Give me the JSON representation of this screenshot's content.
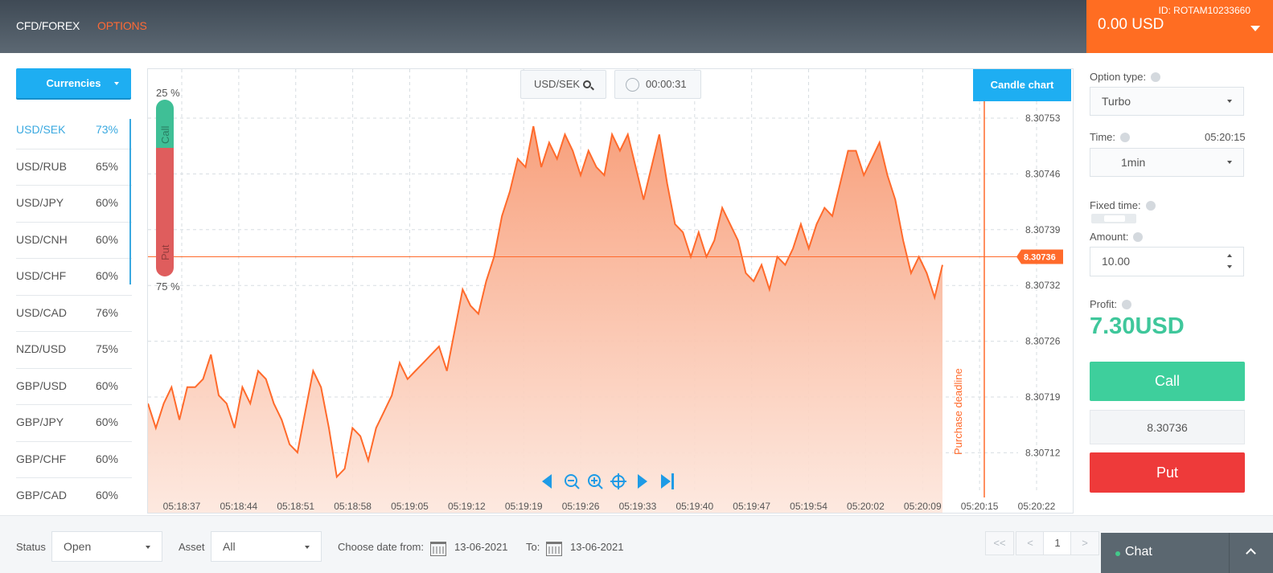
{
  "nav": {
    "cfd": "CFD/FOREX",
    "options": "OPTIONS"
  },
  "account": {
    "id": "ID: ROTAM10233660",
    "balance": "0.00 USD"
  },
  "sidebar": {
    "currencies_label": "Currencies",
    "pairs": [
      {
        "name": "USD/SEK",
        "pct": "73%",
        "active": true
      },
      {
        "name": "USD/RUB",
        "pct": "65%"
      },
      {
        "name": "USD/JPY",
        "pct": "60%"
      },
      {
        "name": "USD/CNH",
        "pct": "60%"
      },
      {
        "name": "USD/CHF",
        "pct": "60%"
      },
      {
        "name": "USD/CAD",
        "pct": "76%"
      },
      {
        "name": "NZD/USD",
        "pct": "75%"
      },
      {
        "name": "GBP/USD",
        "pct": "60%"
      },
      {
        "name": "GBP/JPY",
        "pct": "60%"
      },
      {
        "name": "GBP/CHF",
        "pct": "60%"
      },
      {
        "name": "GBP/CAD",
        "pct": "60%"
      }
    ]
  },
  "chart": {
    "pair": "USD/SEK",
    "timer": "00:00:31",
    "candle_label": "Candle chart",
    "call_pct": "25 %",
    "put_pct": "75 %",
    "call_label": "Call",
    "put_label": "Put",
    "deadline_label": "Purchase deadline",
    "current_price": "8.30736"
  },
  "chart_data": {
    "type": "area",
    "y_ticks": [
      "8.30753",
      "8.30746",
      "8.30739",
      "8.30732",
      "8.30726",
      "8.30719",
      "8.30712"
    ],
    "x_ticks": [
      "05:18:37",
      "05:18:44",
      "05:18:51",
      "05:18:58",
      "05:19:05",
      "05:19:12",
      "05:19:19",
      "05:19:26",
      "05:19:33",
      "05:19:40",
      "05:19:47",
      "05:19:54",
      "05:20:02",
      "05:20:09",
      "05:20:15",
      "05:20:22"
    ],
    "ylim": [
      8.30705,
      8.30758
    ],
    "t_start": 0,
    "t_step": 1,
    "values": [
      8.30718,
      8.30715,
      8.30718,
      8.3072,
      8.30716,
      8.3072,
      8.3072,
      8.30721,
      8.30724,
      8.30719,
      8.30718,
      8.30715,
      8.3072,
      8.30718,
      8.30722,
      8.30721,
      8.30718,
      8.30716,
      8.30713,
      8.30712,
      8.30717,
      8.30722,
      8.3072,
      8.30715,
      8.30709,
      8.3071,
      8.30715,
      8.30714,
      8.30711,
      8.30715,
      8.30717,
      8.30719,
      8.30723,
      8.30721,
      8.30722,
      8.30723,
      8.30724,
      8.30725,
      8.30722,
      8.30727,
      8.30732,
      8.3073,
      8.30729,
      8.30733,
      8.30736,
      8.30741,
      8.30744,
      8.30748,
      8.30747,
      8.30752,
      8.30747,
      8.3075,
      8.30748,
      8.30751,
      8.30749,
      8.30746,
      8.30749,
      8.30747,
      8.30746,
      8.30751,
      8.30749,
      8.30751,
      8.30747,
      8.30743,
      8.30747,
      8.30751,
      8.30745,
      8.3074,
      8.30739,
      8.30736,
      8.30739,
      8.30736,
      8.30738,
      8.30742,
      8.3074,
      8.30738,
      8.30734,
      8.30733,
      8.30735,
      8.30732,
      8.30736,
      8.30735,
      8.30737,
      8.3074,
      8.30737,
      8.3074,
      8.30742,
      8.30741,
      8.30745,
      8.30749,
      8.30749,
      8.30746,
      8.30748,
      8.3075,
      8.30746,
      8.30743,
      8.30738,
      8.30734,
      8.30736,
      8.30734,
      8.30731,
      8.30735
    ],
    "current": 8.30736,
    "deadline_t": 105
  },
  "option": {
    "type_label": "Option type:",
    "type_value": "Turbo",
    "time_label": "Time:",
    "time_clock": "05:20:15",
    "time_value": "1min",
    "fixed_label": "Fixed time:",
    "amount_label": "Amount:",
    "amount_value": "10.00",
    "profit_label": "Profit:",
    "profit_value": "7.30USD",
    "call_label": "Call",
    "price_value": "8.30736",
    "put_label": "Put"
  },
  "bottom": {
    "status_label": "Status",
    "status_value": "Open",
    "asset_label": "Asset",
    "asset_value": "All",
    "from_label": "Choose date from:",
    "from_value": "13-06-2021",
    "to_label": "To:",
    "to_value": "13-06-2021",
    "pager": [
      "<<",
      "<",
      "1",
      ">"
    ],
    "chat_label": "Chat"
  },
  "colors": {
    "accent": "#1eaef2",
    "orange": "#ff6d22",
    "call": "#3ecf9c",
    "put": "#ee3a3a"
  }
}
